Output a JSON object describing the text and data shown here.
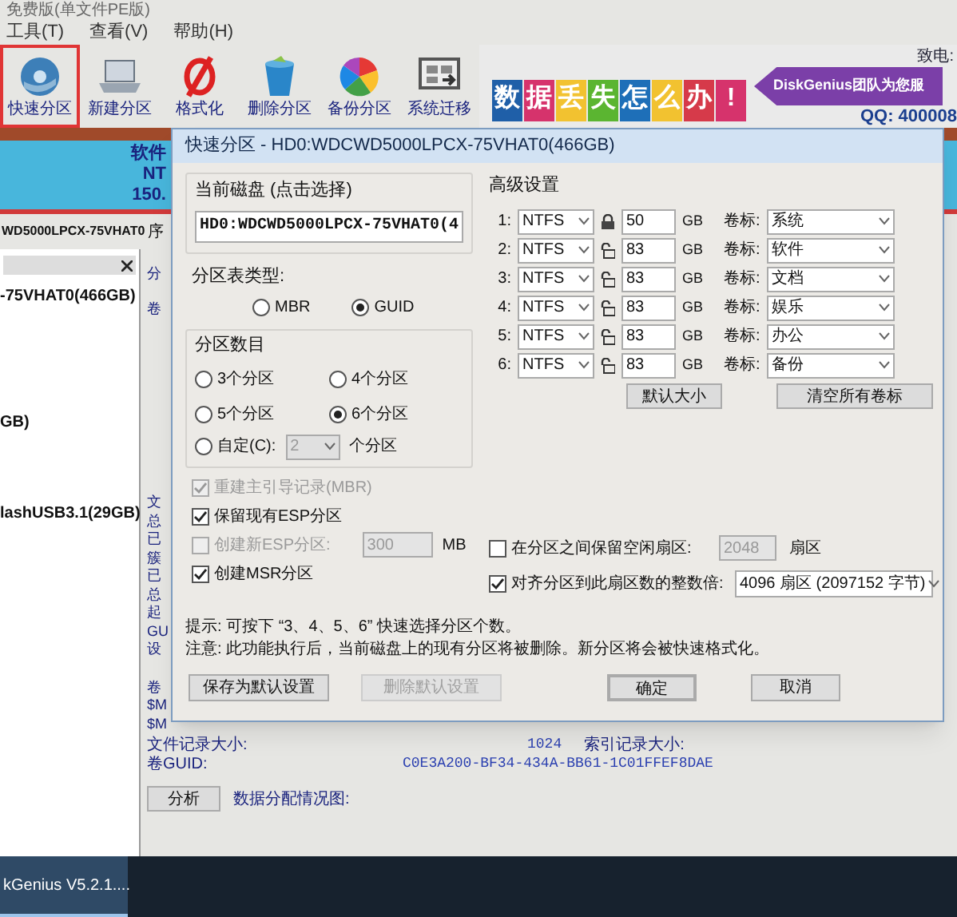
{
  "window": {
    "title": "免费版(单文件PE版)"
  },
  "menu": [
    "工具(T)",
    "查看(V)",
    "帮助(H)"
  ],
  "toolbar": [
    {
      "label": "快速分区",
      "selected": true
    },
    {
      "label": "新建分区",
      "selected": false
    },
    {
      "label": "格式化",
      "selected": false
    },
    {
      "label": "删除分区",
      "selected": false
    },
    {
      "label": "备份分区",
      "selected": false
    },
    {
      "label": "系统迁移",
      "selected": false
    }
  ],
  "banner": {
    "tiles": [
      {
        "text": "数",
        "color": "#1f5fa8"
      },
      {
        "text": "据",
        "color": "#d6336c"
      },
      {
        "text": "丢",
        "color": "#f2c230"
      },
      {
        "text": "失",
        "color": "#5bb531"
      },
      {
        "text": "怎",
        "color": "#1e6fb8"
      },
      {
        "text": "么",
        "color": "#f2c230"
      },
      {
        "text": "办",
        "color": "#d63a4a"
      },
      {
        "text": "!",
        "color": "#d6336c"
      }
    ],
    "slogan": "DiskGenius团队为您服",
    "contact": "致电:",
    "qq": "QQ: 400008"
  },
  "disk_bar": [
    "软件",
    "NT",
    "150."
  ],
  "disk_header": {
    "model": "WD5000LPCX-75VHAT0",
    "column_2": "序"
  },
  "tree": [
    {
      "label": "-75VHAT0(466GB)",
      "selected": false
    },
    {
      "label": "GB)",
      "selected": false
    },
    {
      "label": "lashUSB3.1(29GB)",
      "selected": false
    }
  ],
  "detail_sections": [
    [
      "分",
      "卷"
    ],
    [
      "文",
      "总",
      "已",
      "簇",
      "已",
      "总",
      "起",
      "GU",
      "设"
    ],
    [
      "卷",
      "$M",
      "$M"
    ]
  ],
  "info_rows": [
    {
      "label": "文件记录大小:",
      "value": "1024",
      "label_2": "索引记录大小:"
    },
    {
      "label": "卷GUID:",
      "value": "C0E3A200-BF34-434A-BB61-1C01FFEF8DAE"
    }
  ],
  "analyze_button": "分析",
  "allocation_label": "数据分配情况图:",
  "taskbar": {
    "app": "kGenius V5.2.1...."
  },
  "dialog": {
    "title": "快速分区 - HD0:WDCWD5000LPCX-75VHAT0(466GB)",
    "current_disk": {
      "label": "当前磁盘 (点击选择)",
      "value": "HD0:WDCWD5000LPCX-75VHAT0(4"
    },
    "table_type": {
      "label": "分区表类型:",
      "options": [
        {
          "label": "MBR",
          "selected": false
        },
        {
          "label": "GUID",
          "selected": true
        }
      ]
    },
    "count": {
      "label": "分区数目",
      "options": [
        {
          "label": "3个分区",
          "selected": false
        },
        {
          "label": "4个分区",
          "selected": false
        },
        {
          "label": "5个分区",
          "selected": false
        },
        {
          "label": "6个分区",
          "selected": true
        }
      ],
      "custom": {
        "label": "自定(C):",
        "selected": false,
        "value": "2",
        "suffix": "个分区"
      }
    },
    "options": [
      {
        "label": "重建主引导记录(MBR)",
        "checked": true,
        "disabled": true
      },
      {
        "label": "保留现有ESP分区",
        "checked": true,
        "disabled": false
      },
      {
        "label": "创建新ESP分区:",
        "checked": false,
        "disabled": true,
        "value": "300",
        "unit": "MB"
      },
      {
        "label": "创建MSR分区",
        "checked": true,
        "disabled": false
      }
    ],
    "advanced": {
      "label": "高级设置",
      "partitions": [
        {
          "index": "1:",
          "fs": "NTFS",
          "locked": true,
          "size": "50",
          "unit": "GB",
          "volume_label": "卷标:",
          "volume": "系统"
        },
        {
          "index": "2:",
          "fs": "NTFS",
          "locked": false,
          "size": "83",
          "unit": "GB",
          "volume_label": "卷标:",
          "volume": "软件"
        },
        {
          "index": "3:",
          "fs": "NTFS",
          "locked": false,
          "size": "83",
          "unit": "GB",
          "volume_label": "卷标:",
          "volume": "文档"
        },
        {
          "index": "4:",
          "fs": "NTFS",
          "locked": false,
          "size": "83",
          "unit": "GB",
          "volume_label": "卷标:",
          "volume": "娱乐"
        },
        {
          "index": "5:",
          "fs": "NTFS",
          "locked": false,
          "size": "83",
          "unit": "GB",
          "volume_label": "卷标:",
          "volume": "办公"
        },
        {
          "index": "6:",
          "fs": "NTFS",
          "locked": false,
          "size": "83",
          "unit": "GB",
          "volume_label": "卷标:",
          "volume": "备份"
        }
      ],
      "buttons": [
        "默认大小",
        "清空所有卷标"
      ]
    },
    "gap_option": {
      "label": "在分区之间保留空闲扇区:",
      "checked": false,
      "value": "2048",
      "unit": "扇区"
    },
    "align_option": {
      "label": "对齐分区到此扇区数的整数倍:",
      "checked": true,
      "value": "4096 扇区 (2097152 字节)"
    },
    "tips": [
      "提示: 可按下 “3、4、5、6” 快速选择分区个数。",
      "注意: 此功能执行后，当前磁盘上的现有分区将被删除。新分区将会被快速格式化。"
    ],
    "buttons": [
      {
        "label": "保存为默认设置",
        "disabled": false,
        "default": false
      },
      {
        "label": "删除默认设置",
        "disabled": true,
        "default": false
      },
      {
        "label": "确定",
        "disabled": false,
        "default": true
      },
      {
        "label": "取消",
        "disabled": false,
        "default": false
      }
    ]
  }
}
